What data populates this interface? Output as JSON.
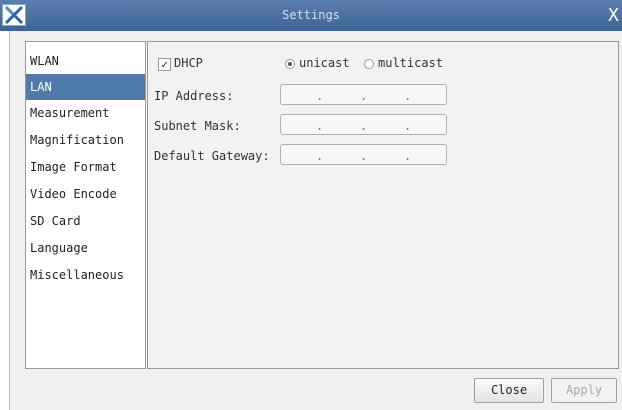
{
  "window": {
    "title": "Settings",
    "app_icon": "x-logo-icon",
    "close_glyph": "X"
  },
  "sidebar": {
    "items": [
      {
        "label": "WLAN",
        "selected": false
      },
      {
        "label": "LAN",
        "selected": true
      },
      {
        "label": "Measurement",
        "selected": false
      },
      {
        "label": "Magnification",
        "selected": false
      },
      {
        "label": "Image Format",
        "selected": false
      },
      {
        "label": "Video Encode",
        "selected": false
      },
      {
        "label": "SD Card",
        "selected": false
      },
      {
        "label": "Language",
        "selected": false
      },
      {
        "label": "Miscellaneous",
        "selected": false
      }
    ]
  },
  "lan": {
    "dhcp": {
      "label": "DHCP",
      "checked": true,
      "check_glyph": "✓"
    },
    "mode": {
      "options": [
        "unicast",
        "multicast"
      ],
      "selected": "unicast"
    },
    "fields": [
      {
        "label": "IP Address:",
        "value": ". . ."
      },
      {
        "label": "Subnet Mask:",
        "value": ". . ."
      },
      {
        "label": "Default Gateway:",
        "value": ". . ."
      }
    ],
    "dot": "."
  },
  "buttons": {
    "close_label": "Close",
    "apply_label": "Apply",
    "apply_enabled": false
  },
  "colors": {
    "titlebar": "#4a6fa0",
    "selected_item": "#4f7aa9"
  }
}
